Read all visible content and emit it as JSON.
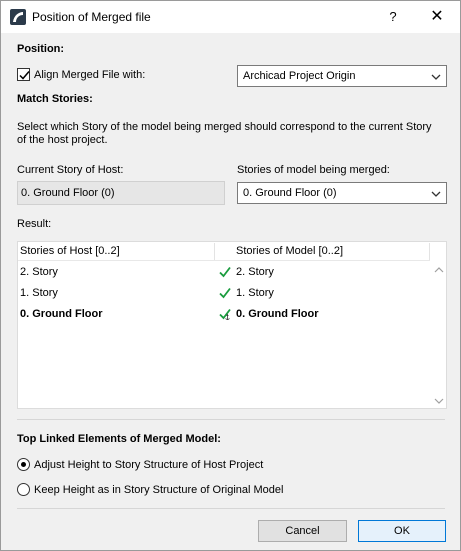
{
  "window": {
    "title": "Position of Merged file",
    "help_label": "?",
    "close_label": "✕"
  },
  "position": {
    "heading": "Position:",
    "align_checkbox_label": "Align Merged File with:",
    "align_checked": true,
    "align_select_value": "Archicad Project Origin"
  },
  "match_stories": {
    "heading": "Match Stories:",
    "description": "Select which Story of the model being merged should correspond to the current Story of the host project.",
    "current_story_label": "Current Story of Host:",
    "current_story_value": "0. Ground Floor (0)",
    "model_stories_label": "Stories of model being merged:",
    "model_stories_value": "0. Ground Floor (0)"
  },
  "result": {
    "label": "Result:",
    "col_host": "Stories of Host [0..2]",
    "col_model": "Stories of Model [0..2]",
    "rows": [
      {
        "host": "2. Story",
        "model": "2. Story",
        "bold": false,
        "anchor": false
      },
      {
        "host": "1. Story",
        "model": "1. Story",
        "bold": false,
        "anchor": false
      },
      {
        "host": "0. Ground Floor",
        "model": "0. Ground Floor",
        "bold": true,
        "anchor": true
      }
    ]
  },
  "top_linked": {
    "heading": "Top Linked Elements of Merged Model:",
    "option_adjust": "Adjust Height to Story Structure of Host Project",
    "option_keep": "Keep Height as in Story Structure of Original Model",
    "selected": "adjust"
  },
  "footer": {
    "cancel_label": "Cancel",
    "ok_label": "OK"
  },
  "colors": {
    "check_green": "#1a9c3e",
    "primary_border": "#0078d7"
  }
}
